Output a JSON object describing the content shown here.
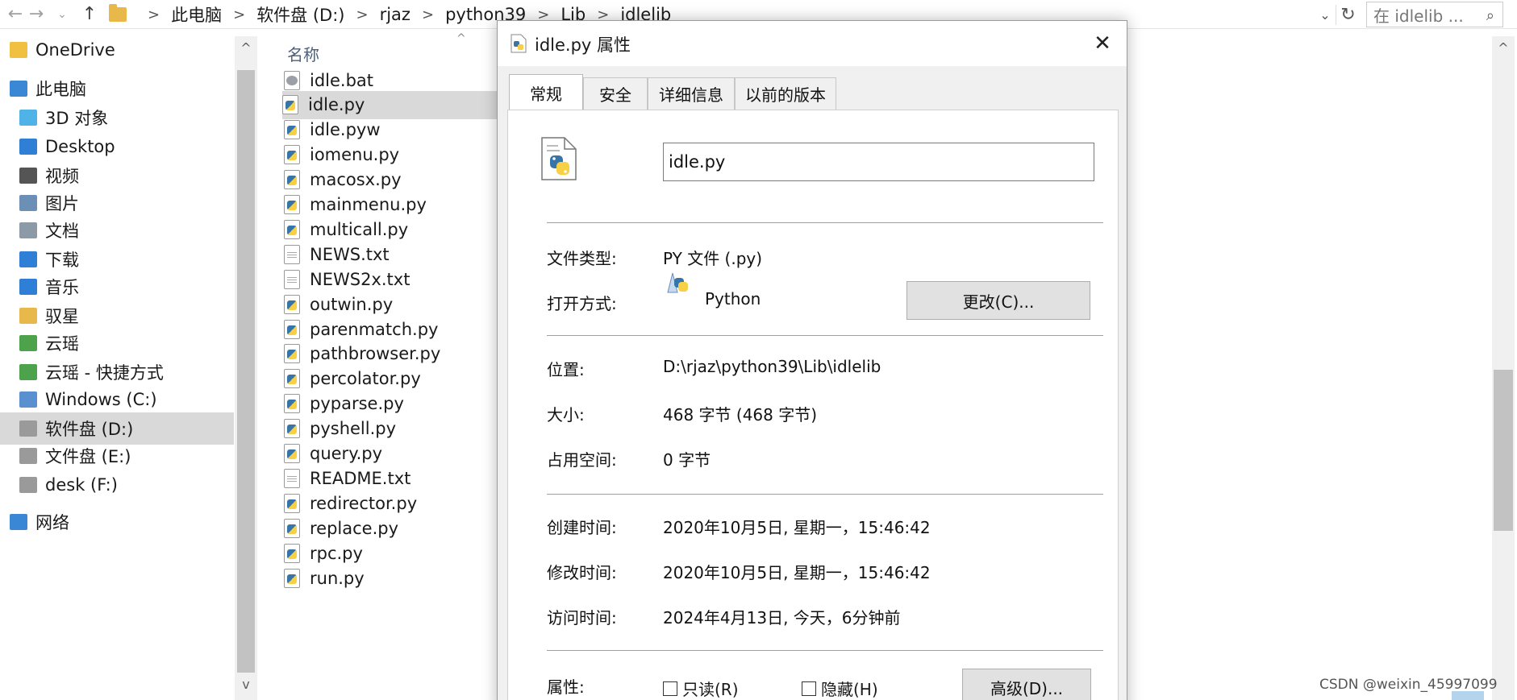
{
  "explorer": {
    "breadcrumbs": [
      "此电脑",
      "软件盘 (D:)",
      "rjaz",
      "python39",
      "Lib",
      "idlelib"
    ],
    "search_placeholder": "在 idlelib ...",
    "column_name": "名称",
    "sidebar": [
      {
        "label": "OneDrive",
        "icon": "onedrive-icon",
        "color": "#f0c040"
      },
      {
        "label": "此电脑",
        "icon": "this-pc-icon",
        "color": "#3a87d6"
      },
      {
        "label": "3D 对象",
        "icon": "3d-objects-icon",
        "color": "#4fb3e8"
      },
      {
        "label": "Desktop",
        "icon": "desktop-icon",
        "color": "#2f7fd6"
      },
      {
        "label": "视频",
        "icon": "video-icon",
        "color": "#555555"
      },
      {
        "label": "图片",
        "icon": "pictures-icon",
        "color": "#6b8fb5"
      },
      {
        "label": "文档",
        "icon": "documents-icon",
        "color": "#8c9aa8"
      },
      {
        "label": "下载",
        "icon": "download-icon",
        "color": "#2f7fd6"
      },
      {
        "label": "音乐",
        "icon": "music-icon",
        "color": "#2f7fd6"
      },
      {
        "label": "驭星",
        "icon": "folder-icon",
        "color": "#e8b84b"
      },
      {
        "label": "云瑶",
        "icon": "network-folder-icon",
        "color": "#4ca34c"
      },
      {
        "label": "云瑶 - 快捷方式",
        "icon": "shortcut-icon",
        "color": "#4ca34c"
      },
      {
        "label": "Windows (C:)",
        "icon": "drive-c-icon",
        "color": "#5a8fd0"
      },
      {
        "label": "软件盘 (D:)",
        "icon": "drive-icon",
        "color": "#9a9a9a"
      },
      {
        "label": "文件盘 (E:)",
        "icon": "drive-icon",
        "color": "#9a9a9a"
      },
      {
        "label": "desk (F:)",
        "icon": "drive-icon",
        "color": "#9a9a9a"
      },
      {
        "label": "网络",
        "icon": "network-icon",
        "color": "#3a87d6"
      }
    ],
    "files": [
      {
        "name": "idle.bat",
        "type": "bat"
      },
      {
        "name": "idle.py",
        "type": "py"
      },
      {
        "name": "idle.pyw",
        "type": "py"
      },
      {
        "name": "iomenu.py",
        "type": "py"
      },
      {
        "name": "macosx.py",
        "type": "py"
      },
      {
        "name": "mainmenu.py",
        "type": "py"
      },
      {
        "name": "multicall.py",
        "type": "py"
      },
      {
        "name": "NEWS.txt",
        "type": "txt"
      },
      {
        "name": "NEWS2x.txt",
        "type": "txt"
      },
      {
        "name": "outwin.py",
        "type": "py"
      },
      {
        "name": "parenmatch.py",
        "type": "py"
      },
      {
        "name": "pathbrowser.py",
        "type": "py"
      },
      {
        "name": "percolator.py",
        "type": "py"
      },
      {
        "name": "pyparse.py",
        "type": "py"
      },
      {
        "name": "pyshell.py",
        "type": "py"
      },
      {
        "name": "query.py",
        "type": "py"
      },
      {
        "name": "README.txt",
        "type": "txt"
      },
      {
        "name": "redirector.py",
        "type": "py"
      },
      {
        "name": "replace.py",
        "type": "py"
      },
      {
        "name": "rpc.py",
        "type": "py"
      },
      {
        "name": "run.py",
        "type": "py"
      }
    ]
  },
  "dialog": {
    "title": "idle.py 属性",
    "tabs": [
      "常规",
      "安全",
      "详细信息",
      "以前的版本"
    ],
    "file_name": "idle.py",
    "file_type_label": "文件类型:",
    "file_type_value": "PY 文件 (.py)",
    "open_with_label": "打开方式:",
    "open_with_value": "Python",
    "change_button": "更改(C)...",
    "location_label": "位置:",
    "location_value": "D:\\rjaz\\python39\\Lib\\idlelib",
    "size_label": "大小:",
    "size_value": "468 字节 (468 字节)",
    "disk_size_label": "占用空间:",
    "disk_size_value": "0 字节",
    "created_label": "创建时间:",
    "created_value": "2020年10月5日, 星期一，15:46:42",
    "modified_label": "修改时间:",
    "modified_value": "2020年10月5日, 星期一，15:46:42",
    "accessed_label": "访问时间:",
    "accessed_value": "2024年4月13日, 今天，6分钟前",
    "attributes_label": "属性:",
    "readonly_label": "只读(R)",
    "hidden_label": "隐藏(H)",
    "advanced_button": "高级(D)..."
  },
  "watermark": "CSDN @weixin_45997099"
}
